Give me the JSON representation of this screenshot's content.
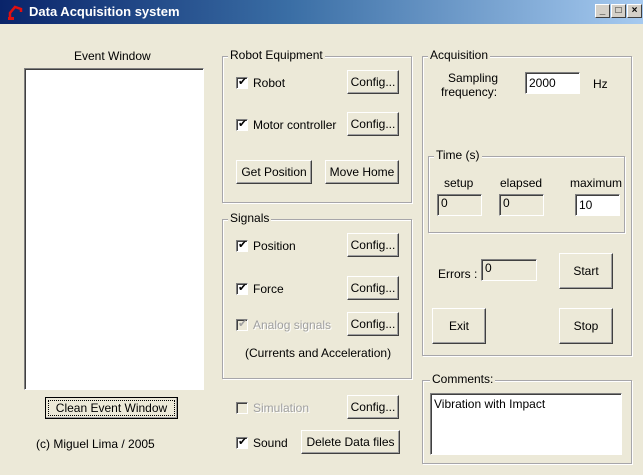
{
  "window": {
    "title": "Data Acquisition system",
    "min": "_",
    "max": "□",
    "close": "×"
  },
  "event_window": {
    "label": "Event Window",
    "clean_button": "Clean Event Window",
    "copyright": "(c) Miguel Lima  / 2005"
  },
  "robot": {
    "label": "Robot Equipment",
    "robot_check": "Robot",
    "robot_config": "Config...",
    "motor_check": "Motor controller",
    "motor_config": "Config...",
    "get_position": "Get Position",
    "move_home": "Move Home"
  },
  "signals": {
    "label": "Signals",
    "position_check": "Position",
    "position_config": "Config...",
    "force_check": "Force",
    "force_config": "Config...",
    "analog_check": "Analog signals",
    "analog_config": "Config...",
    "note": "(Currents and Acceleration)"
  },
  "bottom": {
    "simulation_check": "Simulation",
    "simulation_config": "Config...",
    "sound_check": "Sound",
    "delete_button": "Delete Data files"
  },
  "acquisition": {
    "label": "Acquisition",
    "sampling_label_1": "Sampling",
    "sampling_label_2": "frequency:",
    "sampling_value": "2000",
    "unit": "Hz",
    "time": {
      "label": "Time (s)",
      "setup_label": "setup",
      "elapsed_label": "elapsed",
      "maximum_label": "maximum",
      "setup_value": "0",
      "elapsed_value": "0",
      "maximum_value": "10"
    },
    "errors_label": "Errors :",
    "errors_value": "0",
    "start": "Start",
    "exit": "Exit",
    "stop": "Stop"
  },
  "comments": {
    "label": "Comments:",
    "value": "Vibration with Impact"
  },
  "checks": {
    "mark": "✔"
  }
}
